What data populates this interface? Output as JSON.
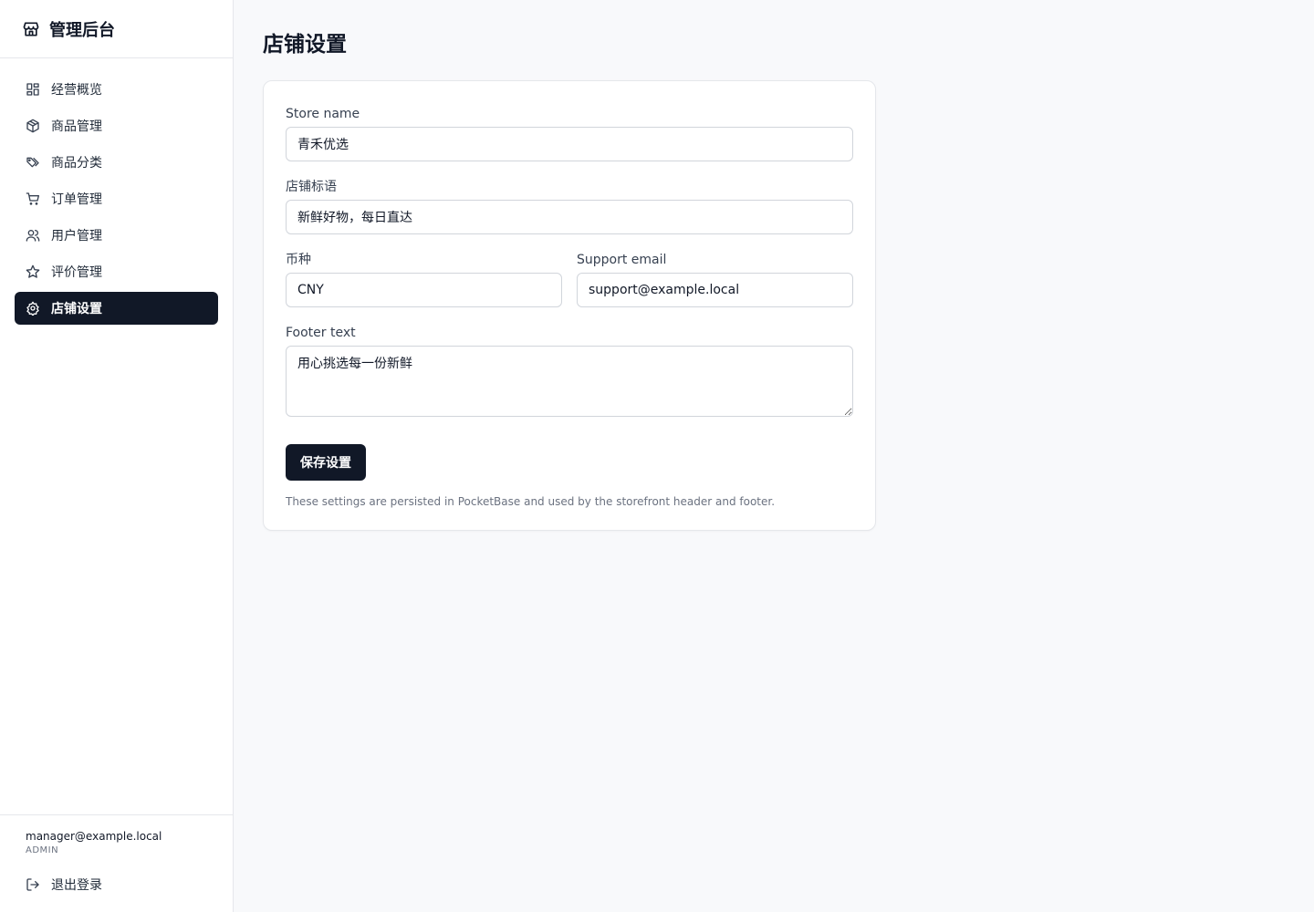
{
  "brand": {
    "title": "管理后台",
    "icon": "store-icon"
  },
  "sidebar": {
    "items": [
      {
        "label": "经营概览",
        "icon": "dashboard-icon"
      },
      {
        "label": "商品管理",
        "icon": "box-icon"
      },
      {
        "label": "商品分类",
        "icon": "tags-icon"
      },
      {
        "label": "订单管理",
        "icon": "cart-icon"
      },
      {
        "label": "用户管理",
        "icon": "users-icon"
      },
      {
        "label": "评价管理",
        "icon": "star-icon"
      },
      {
        "label": "店铺设置",
        "icon": "gear-icon",
        "active": true
      }
    ],
    "user": {
      "email": "manager@example.local",
      "role": "ADMIN"
    },
    "logout_label": "退出登录"
  },
  "main": {
    "title": "店铺设置",
    "form": {
      "store_name": {
        "label": "Store name",
        "value": "青禾优选"
      },
      "tagline": {
        "label": "店铺标语",
        "value": "新鲜好物，每日直达"
      },
      "currency": {
        "label": "币种",
        "value": "CNY"
      },
      "support_email": {
        "label": "Support email",
        "value": "support@example.local"
      },
      "footer_text": {
        "label": "Footer text",
        "value": "用心挑选每一份新鲜"
      },
      "save_label": "保存设置",
      "hint": "These settings are persisted in PocketBase and used by the storefront header and footer."
    }
  },
  "colors": {
    "accent": "#111827",
    "border": "#e5e7eb",
    "background": "#f8f9fb"
  }
}
